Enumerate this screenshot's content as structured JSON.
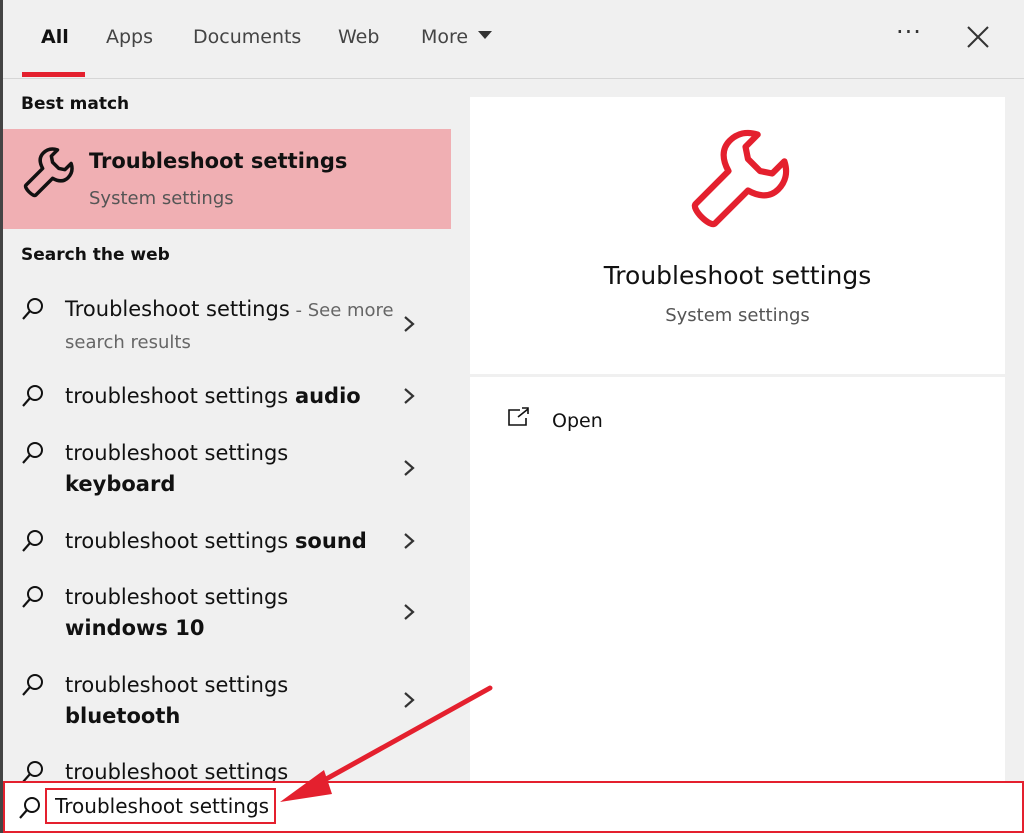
{
  "tabs": [
    {
      "label": "All",
      "active": true
    },
    {
      "label": "Apps"
    },
    {
      "label": "Documents"
    },
    {
      "label": "Web"
    },
    {
      "label": "More"
    }
  ],
  "accent_color": "#e4202e",
  "highlight_color": "#f0afb3",
  "best_match": {
    "heading": "Best match",
    "title": "Troubleshoot settings",
    "subtitle": "System settings",
    "icon": "wrench-icon"
  },
  "web": {
    "heading": "Search the web",
    "items": [
      {
        "text": "Troubleshoot settings",
        "dim": " - See more search results"
      },
      {
        "text": "troubleshoot settings ",
        "bold": "audio"
      },
      {
        "text": "troubleshoot settings ",
        "bold": "keyboard"
      },
      {
        "text": "troubleshoot settings ",
        "bold": "sound"
      },
      {
        "text": "troubleshoot settings ",
        "bold": "windows 10"
      },
      {
        "text": "troubleshoot settings ",
        "bold": "bluetooth"
      },
      {
        "text": "troubleshoot settings",
        "bold": ""
      }
    ]
  },
  "preview": {
    "title": "Troubleshoot settings",
    "subtitle": "System settings",
    "icon": "wrench-icon"
  },
  "actions": {
    "open_label": "Open",
    "open_icon": "open-window-icon"
  },
  "search": {
    "value": "Troubleshoot settings",
    "icon": "search-icon"
  }
}
